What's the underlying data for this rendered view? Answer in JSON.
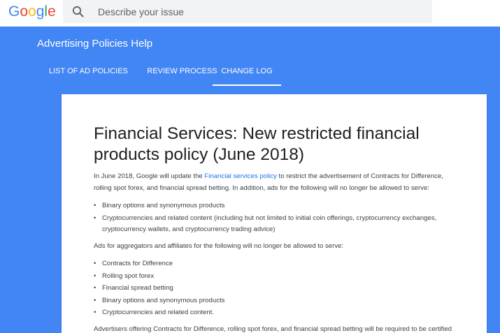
{
  "topbar": {
    "logo_letters": [
      {
        "char": "G",
        "color": "#4285f4"
      },
      {
        "char": "o",
        "color": "#ea4335"
      },
      {
        "char": "o",
        "color": "#fbbc05"
      },
      {
        "char": "g",
        "color": "#4285f4"
      },
      {
        "char": "l",
        "color": "#34a853"
      },
      {
        "char": "e",
        "color": "#ea4335"
      }
    ],
    "search_icon": "search-icon",
    "search_placeholder": "Describe your issue"
  },
  "header": {
    "title": "Advertising Policies Help",
    "tabs": [
      {
        "label": "LIST OF AD POLICIES",
        "active": false
      },
      {
        "label": "REVIEW PROCESS",
        "active": false
      },
      {
        "label": "CHANGE LOG",
        "active": true
      }
    ]
  },
  "article": {
    "title": "Financial Services: New restricted financial products policy (June 2018)",
    "intro_before_link": "In June 2018, Google will update the ",
    "intro_link": "Financial services policy",
    "intro_after_link": " to restrict the advertisement of Contracts for Difference, rolling spot forex, and financial spread betting. In addition, ads for the following will no longer be allowed to serve:",
    "list1": [
      "Binary options and synonymous products",
      "Cryptocurrencies and related content (including but not limited to initial coin offerings, cryptocurrency exchanges, cryptocurrency wallets, and cryptocurrency trading advice)"
    ],
    "para2": "Ads for aggregators and affiliates for the following will no longer be allowed to serve:",
    "list2": [
      "Contracts for Difference",
      "Rolling spot forex",
      "Financial spread betting",
      "Binary options and synonymous products",
      "Cryptocurrencies and related content."
    ],
    "para3": "Advertisers offering Contracts for Difference, rolling spot forex, and financial spread betting will be required to be certified"
  },
  "colors": {
    "brand_blue": "#4285f4",
    "link_blue": "#1a73e8",
    "search_bg": "#f1f3f4"
  }
}
